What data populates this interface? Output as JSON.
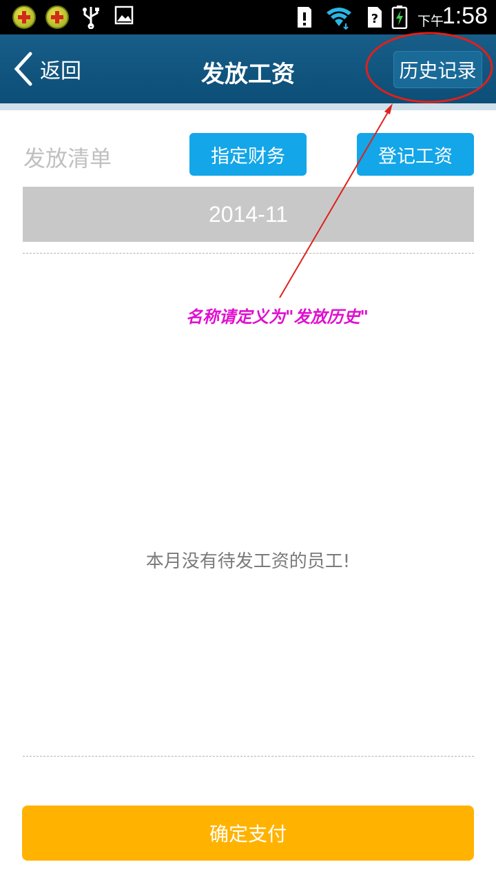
{
  "status_bar": {
    "ampm": "下午",
    "time": "1:58",
    "icons": [
      "app-360-icon",
      "app-360-icon",
      "usb-icon",
      "image-icon",
      "sd-card-icon",
      "wifi-icon",
      "no-sim-icon",
      "battery-charging-icon"
    ]
  },
  "header": {
    "back_label": "返回",
    "title": "发放工资",
    "history_label": "历史记录"
  },
  "annotation": {
    "text": "名称请定义为\"发放历史\"",
    "color": "#e010d0",
    "mark_color": "#e0201a"
  },
  "main": {
    "list_label": "发放清单",
    "assign_finance_label": "指定财务",
    "register_salary_label": "登记工资",
    "month": "2014-11",
    "empty_message": "本月没有待发工资的员工!",
    "confirm_label": "确定支付"
  },
  "colors": {
    "header_bg": "#0f5580",
    "button_blue": "#13a6e8",
    "button_orange": "#ffb300",
    "month_bar": "#c8c8c8"
  }
}
